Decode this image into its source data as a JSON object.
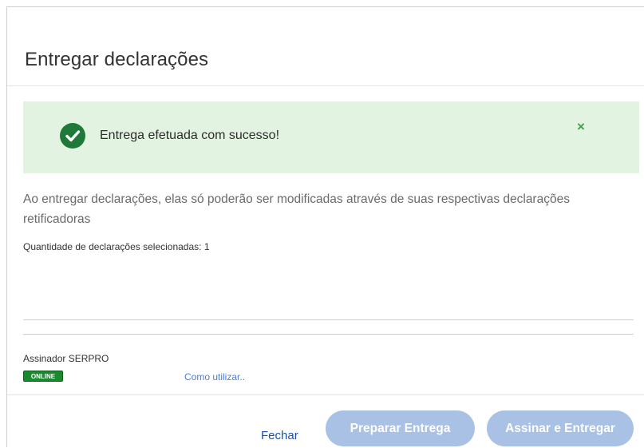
{
  "dialog": {
    "title": "Entregar declarações"
  },
  "alert": {
    "message": "Entrega efetuada com sucesso!",
    "close_label": "×",
    "icon": "check-circle-icon",
    "color": "#e3f3e1"
  },
  "body": {
    "info": "Ao entregar declarações, elas só poderão ser modificadas através de suas respectivas declarações retificadoras",
    "quantity": "Quantidade de declarações selecionadas: 1"
  },
  "signer": {
    "label": "Assinador SERPRO",
    "status": "ONLINE",
    "help_link": "Como utilizar.."
  },
  "footer": {
    "close_label": "Fechar",
    "prepare_label": "Preparar Entrega",
    "sign_label": "Assinar e Entregar",
    "button_color": "#a8c1e4",
    "link_color": "#1351b4"
  }
}
